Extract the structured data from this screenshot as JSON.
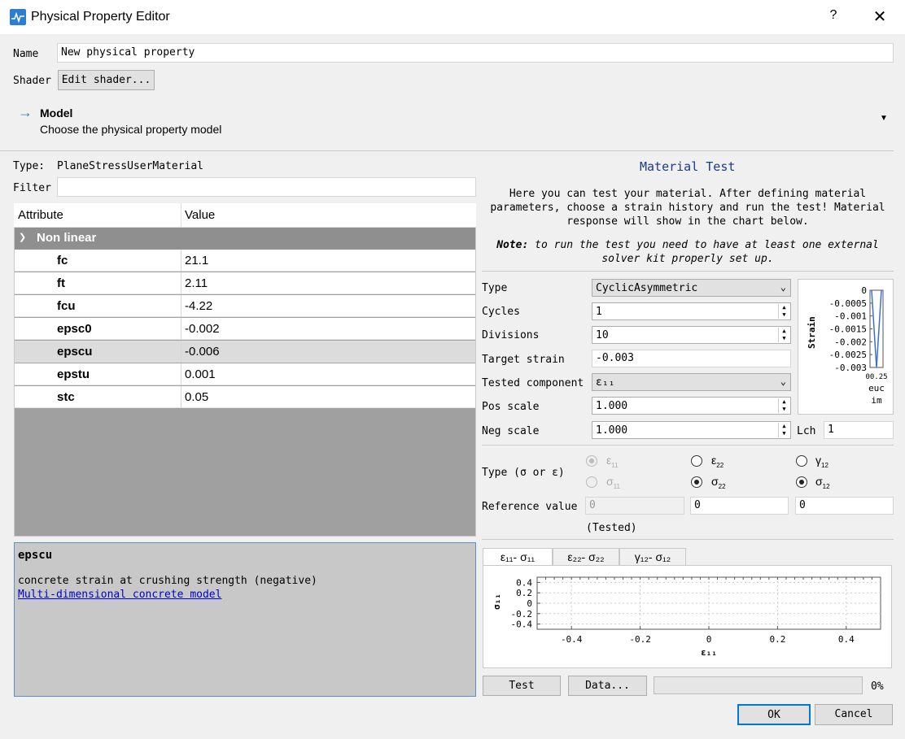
{
  "window": {
    "title": "Physical Property Editor",
    "help": "?",
    "close": "✕"
  },
  "name": {
    "label": "Name",
    "value": "New physical property"
  },
  "shader": {
    "label": "Shader",
    "button": "Edit shader..."
  },
  "model": {
    "title": "Model",
    "subtitle": "Choose the physical property model"
  },
  "type_label": "Type:",
  "type_value": "PlaneStressUserMaterial",
  "filter": {
    "label": "Filter",
    "value": ""
  },
  "table": {
    "headers": [
      "Attribute",
      "Value"
    ],
    "group": "Non linear",
    "rows": [
      {
        "name": "fc",
        "value": "21.1"
      },
      {
        "name": "ft",
        "value": "2.11"
      },
      {
        "name": "fcu",
        "value": "-4.22"
      },
      {
        "name": "epsc0",
        "value": "-0.002"
      },
      {
        "name": "epscu",
        "value": "-0.006"
      },
      {
        "name": "epstu",
        "value": "0.001"
      },
      {
        "name": "stc",
        "value": "0.05"
      }
    ]
  },
  "description": {
    "title": "epscu",
    "text": "concrete strain at crushing strength (negative)",
    "link": "Multi-dimensional concrete model"
  },
  "material_test": {
    "title": "Material Test",
    "intro": [
      "Here you can test your material. After defining material",
      "parameters, choose a strain history and run the test! Material",
      "response will show in the chart below."
    ],
    "note_label": "Note:",
    "note": [
      " to run the test you need to have at least one external",
      "solver kit properly set up."
    ],
    "type": {
      "label": "Type",
      "value": "CyclicAsymmetric"
    },
    "cycles": {
      "label": "Cycles",
      "value": "1"
    },
    "divisions": {
      "label": "Divisions",
      "value": "10"
    },
    "target_strain": {
      "label": "Target strain",
      "value": "-0.003"
    },
    "tested_component": {
      "label": "Tested component",
      "value": "ε₁₁"
    },
    "pos_scale": {
      "label": "Pos scale",
      "value": "1.000"
    },
    "neg_scale": {
      "label": "Neg scale",
      "value": "1.000"
    },
    "lch": {
      "label": "Lch",
      "value": "1"
    },
    "type_sigma_eps": {
      "label": "Type (σ or ε)"
    },
    "reference_value": {
      "label": "Reference value",
      "values": [
        "0",
        "0",
        "0"
      ],
      "tested": "(Tested)"
    },
    "tabs": [
      "ε₁₁- σ₁₁",
      "ε₂₂- σ₂₂",
      "γ₁₂- σ₁₂"
    ],
    "buttons": {
      "test": "Test",
      "data": "Data...",
      "progress": "0%"
    },
    "mini_chart": {
      "ylabel": "Strain",
      "xlabel1": "euc",
      "xlabel2": "im",
      "xtick": "00.25",
      "yticks": [
        "0",
        "-0.0005",
        "-0.001",
        "-0.0015",
        "-0.002",
        "-0.0025",
        "-0.003"
      ]
    },
    "main_chart": {
      "ylabel": "σ₁₁",
      "xlabel": "ε₁₁",
      "yticks": [
        "0.4",
        "0.2",
        "0",
        "-0.2",
        "-0.4"
      ],
      "xticks": [
        "-0.4",
        "-0.2",
        "0",
        "0.2",
        "0.4"
      ]
    }
  },
  "chart_data": [
    {
      "type": "line",
      "title": "",
      "xlabel": "euc im",
      "ylabel": "Strain",
      "ylim": [
        -0.003,
        0
      ],
      "series": [
        {
          "values": [
            0,
            -0.003,
            0
          ]
        }
      ]
    },
    {
      "type": "line",
      "title": "",
      "xlabel": "ε₁₁",
      "ylabel": "σ₁₁",
      "xlim": [
        -0.5,
        0.5
      ],
      "ylim": [
        -0.5,
        0.5
      ],
      "series": []
    }
  ],
  "dialog": {
    "ok": "OK",
    "cancel": "Cancel"
  }
}
